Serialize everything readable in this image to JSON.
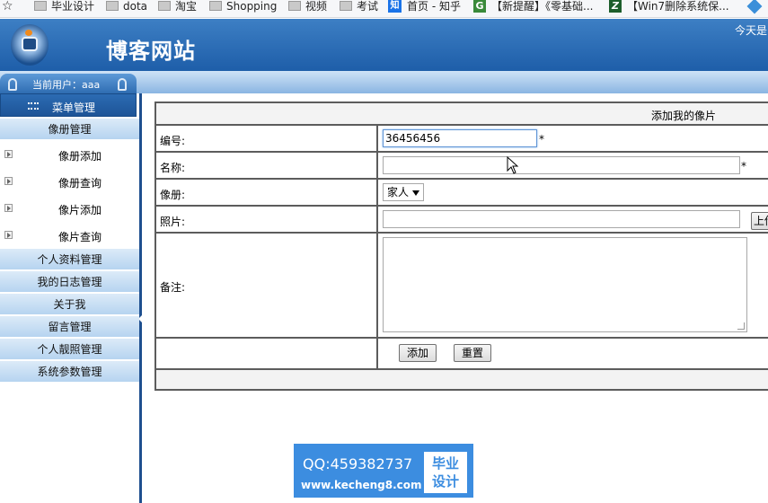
{
  "bookmarks": [
    {
      "label": "毕业设计",
      "icon": "folder-icon"
    },
    {
      "label": "dota",
      "icon": "folder-icon"
    },
    {
      "label": "淘宝",
      "icon": "folder-icon"
    },
    {
      "label": "Shopping",
      "icon": "folder-icon"
    },
    {
      "label": "视频",
      "icon": "folder-icon"
    },
    {
      "label": "考试",
      "icon": "folder-icon"
    },
    {
      "label": "首页 - 知乎",
      "icon": "zhihu-icon",
      "glyph": "知"
    },
    {
      "label": "【新提醒】《零基础...",
      "icon": "g-icon",
      "glyph": "G"
    },
    {
      "label": "【Win7删除系统保...",
      "icon": "z-icon",
      "glyph": "Z"
    }
  ],
  "header": {
    "site_title": "博客网站",
    "today_text": "今天是"
  },
  "user_bar": {
    "label": "当前用户：aaa"
  },
  "sidebar": {
    "menu_head": "菜单管理",
    "photo_album_category": "像册管理",
    "subitems": [
      "像册添加",
      "像册查询",
      "像片添加",
      "像片查询"
    ],
    "categories": [
      "个人资料管理",
      "我的日志管理",
      "关于我",
      "留言管理",
      "个人靓照管理",
      "系统参数管理"
    ]
  },
  "form": {
    "title": "添加我的像片",
    "fields": {
      "id_label": "编号:",
      "id_value": "36456456",
      "name_label": "名称:",
      "name_value": "",
      "album_label": "像册:",
      "album_selected": "家人",
      "photo_label": "照片:",
      "photo_value": "",
      "upload_label": "上传",
      "notes_label": "备注:"
    },
    "required_mark": "*",
    "buttons": {
      "add": "添加",
      "reset": "重置"
    }
  },
  "watermark": {
    "qq": "QQ:459382737",
    "url": "www.kecheng8.com",
    "badge_line1": "毕业",
    "badge_line2": "设计"
  },
  "colors": {
    "header_blue": "#1e5ea9",
    "sidebar_blue": "#2c6cb3",
    "category_bg": "#cfe3f6",
    "watermark_blue": "#3c8de0"
  }
}
